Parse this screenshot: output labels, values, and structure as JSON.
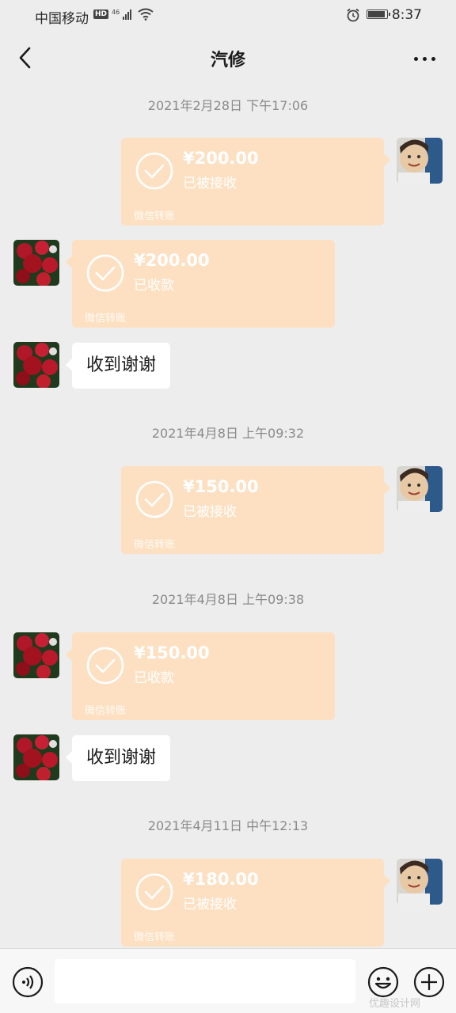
{
  "status_bar": {
    "carrier": "中国移动",
    "network_badge": "HD",
    "network_type": "46",
    "time": "8:37",
    "battery_level": 0.95,
    "icons": [
      "hd-icon",
      "signal-icon",
      "wifi-icon",
      "alarm-icon",
      "battery-icon"
    ]
  },
  "header": {
    "title": "汽修",
    "back_icon": "chevron-left-icon",
    "more_icon": "more-dots-icon"
  },
  "messages": [
    {
      "type": "timestamp",
      "text": "2021年2月28日 下午17:06"
    },
    {
      "type": "transfer",
      "side": "right",
      "amount": "¥200.00",
      "status": "已被接收",
      "footer": "微信转账"
    },
    {
      "type": "transfer",
      "side": "left",
      "amount": "¥200.00",
      "status": "已收款",
      "footer": "微信转账"
    },
    {
      "type": "text",
      "side": "left",
      "text": "收到谢谢"
    },
    {
      "type": "timestamp",
      "text": "2021年4月8日 上午09:32"
    },
    {
      "type": "transfer",
      "side": "right",
      "amount": "¥150.00",
      "status": "已被接收",
      "footer": "微信转账"
    },
    {
      "type": "timestamp",
      "text": "2021年4月8日 上午09:38"
    },
    {
      "type": "transfer",
      "side": "left",
      "amount": "¥150.00",
      "status": "已收款",
      "footer": "微信转账"
    },
    {
      "type": "text",
      "side": "left",
      "text": "收到谢谢"
    },
    {
      "type": "timestamp",
      "text": "2021年4月11日 中午12:13"
    },
    {
      "type": "transfer",
      "side": "right",
      "amount": "¥180.00",
      "status": "已被接收",
      "footer": "微信转账"
    }
  ],
  "input_bar": {
    "input_value": "",
    "watermark": "优趣设计网"
  },
  "colors": {
    "background": "#ededed",
    "transfer_bubble": "#fde0c2",
    "text_bubble": "#ffffff",
    "timestamp": "#8a8a8a"
  }
}
